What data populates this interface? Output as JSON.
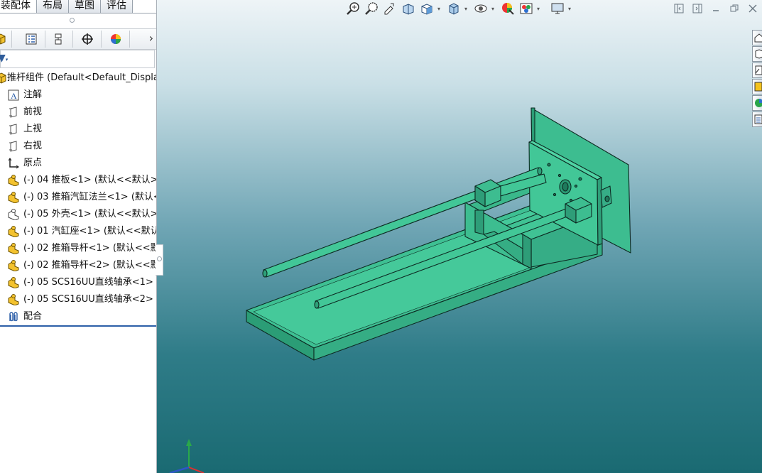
{
  "tabs": [
    "装配体",
    "布局",
    "草图",
    "评估"
  ],
  "active_tab": 0,
  "manager_tabs": [
    "feature-manager-icon",
    "property-manager-icon",
    "configuration-manager-icon",
    "dimxpert-icon",
    "display-manager-icon"
  ],
  "manager_more": "›",
  "filter_icon": "filter-icon",
  "tree": {
    "root": "推杆组件  (Default<Default_Display",
    "items": [
      {
        "icon": "annotation-icon",
        "label": "注解"
      },
      {
        "icon": "plane-icon",
        "label": "前视"
      },
      {
        "icon": "plane-icon",
        "label": "上视"
      },
      {
        "icon": "plane-icon",
        "label": "右视"
      },
      {
        "icon": "origin-icon",
        "label": "原点"
      },
      {
        "icon": "part-icon",
        "label": "(-) 04 推板<1> (默认<<默认>_"
      },
      {
        "icon": "part-icon",
        "label": "(-) 03 推箱汽缸法兰<1> (默认<"
      },
      {
        "icon": "part-outline-icon",
        "label": "(-) 05 外壳<1> (默认<<默认>_"
      },
      {
        "icon": "part-icon",
        "label": "(-) 01 汽缸座<1> (默认<<默认"
      },
      {
        "icon": "part-icon",
        "label": "(-) 02 推箱导杆<1> (默认<<默"
      },
      {
        "icon": "part-icon",
        "label": "(-) 02 推箱导杆<2> (默认<<默"
      },
      {
        "icon": "part-icon",
        "label": "(-) 05 SCS16UU直线轴承<1> ("
      },
      {
        "icon": "part-icon",
        "label": "(-) 05 SCS16UU直线轴承<2> ("
      },
      {
        "icon": "mates-icon",
        "label": "配合"
      }
    ]
  },
  "heads_up_toolbar": [
    "zoom-to-fit-icon",
    "zoom-to-area-icon",
    "previous-view-icon",
    "section-view-icon",
    "view-orientation-icon",
    "display-style-icon",
    "hide-show-items-icon",
    "edit-appearance-icon",
    "apply-scene-icon",
    "view-settings-icon"
  ],
  "window_controls": [
    "tile-left-icon",
    "tile-right-icon",
    "minimize-icon",
    "restore-icon",
    "close-icon"
  ],
  "task_pane": [
    "home-icon",
    "design-library-icon",
    "file-explorer-icon",
    "view-palette-icon",
    "appearances-icon",
    "custom-properties-icon"
  ],
  "colors": {
    "model_face": "#3dba8e",
    "model_face_dark": "#2f9c76",
    "model_edge": "#0d2a22",
    "selection_line": "#2d5fa8"
  }
}
